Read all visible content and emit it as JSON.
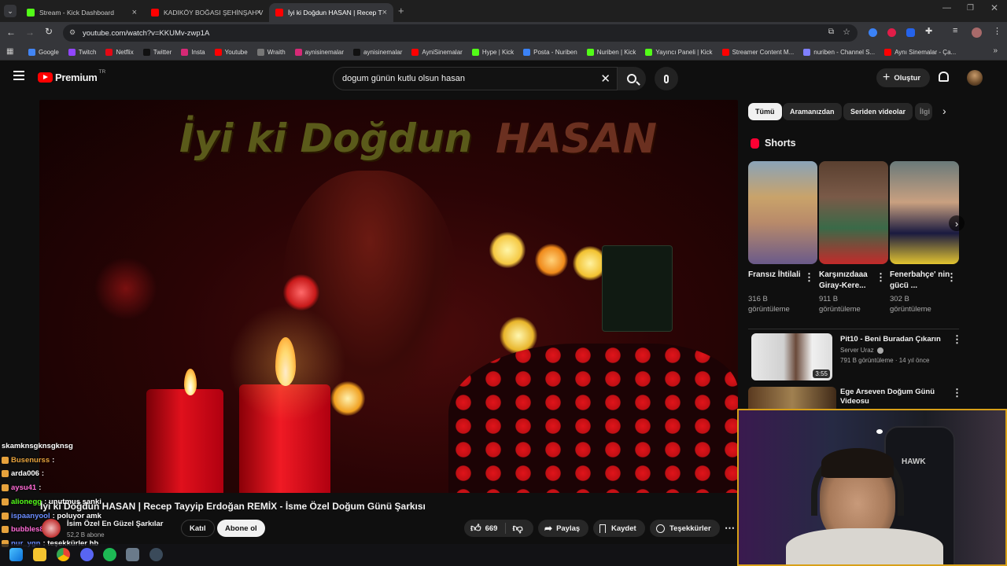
{
  "browser": {
    "tabs": [
      {
        "label": "Stream - Kick Dashboard",
        "color": "#53fc18"
      },
      {
        "label": "KADIKÖY BOĞASI ŞEHİNŞAH V",
        "color": "#ff0000"
      },
      {
        "label": "İyi ki Doğdun HASAN | Recep T",
        "color": "#ff0000"
      }
    ],
    "url": "youtube.com/watch?v=KKUMv-zwp1A",
    "bookmarks": [
      {
        "label": "Google",
        "color": "#4285f4"
      },
      {
        "label": "Twitch",
        "color": "#9146ff"
      },
      {
        "label": "Netflix",
        "color": "#e50914"
      },
      {
        "label": "Twitter",
        "color": "#111111"
      },
      {
        "label": "Insta",
        "color": "#d62976"
      },
      {
        "label": "Youtube",
        "color": "#ff0000"
      },
      {
        "label": "Wraith",
        "color": "#777777"
      },
      {
        "label": "aynisinemalar",
        "color": "#d62976"
      },
      {
        "label": "aynisinemalar",
        "color": "#111111"
      },
      {
        "label": "AyniSinemalar",
        "color": "#ff0000"
      },
      {
        "label": "Hype | Kick",
        "color": "#53fc18"
      },
      {
        "label": "Posta - Nuriben",
        "color": "#3b82f6"
      },
      {
        "label": "Nuriben | Kick",
        "color": "#53fc18"
      },
      {
        "label": "Yayıncı Paneli | Kick",
        "color": "#53fc18"
      },
      {
        "label": "Streamer Content M...",
        "color": "#ff0000"
      },
      {
        "label": "nuriben - Channel S...",
        "color": "#8080ff"
      },
      {
        "label": "Aynı Sinemalar - Ça...",
        "color": "#ff0000"
      }
    ]
  },
  "youtube": {
    "logo_text": "Premium",
    "region": "TR",
    "search_value": "dogum günün kutlu olsun hasan",
    "create_label": "Oluştur"
  },
  "video": {
    "overlay_left": "İyi ki Doğdun",
    "overlay_right": "HASAN",
    "title": "İyi ki Doğdun HASAN | Recep Tayyip Erdoğan REMİX - İsme Özel Doğum Günü Şarkısı",
    "channel": "İsim Özel En Güzel Şarkılar",
    "subscribers": "52,2 B abone",
    "join_label": "Katıl",
    "subscribe_label": "Abone ol",
    "likes": "669",
    "share_label": "Paylaş",
    "save_label": "Kaydet",
    "thanks_label": "Teşekkürler"
  },
  "sidebar": {
    "chips": [
      "Tümü",
      "Aramanızdan",
      "Seriden videolar",
      "İlgi"
    ],
    "shorts_heading": "Shorts",
    "shorts": [
      {
        "title": "Fransız İhtilali",
        "views": "316 B görüntüleme"
      },
      {
        "title": "Karşınızdaaa Giray-Kere...",
        "views": "911 B görüntüleme"
      },
      {
        "title": "Fenerbahçe' nin gücü ...",
        "views": "302 B görüntüleme"
      }
    ],
    "recs": [
      {
        "title": "Pit10 - Beni Buradan Çıkarın",
        "channel": "Server Uraz",
        "meta": "791 B görüntüleme · 14 yıl önce",
        "duration": "3:55"
      },
      {
        "title": "Ege Arseven Doğum Günü Videosu"
      }
    ]
  },
  "chat": [
    {
      "user": "",
      "text": "skamknsgknsgknsg",
      "color": "#ffffff"
    },
    {
      "user": "Busenurss",
      "text": ":",
      "color": "#e6a23c"
    },
    {
      "user": "arda006",
      "text": ":",
      "color": "#ffffff"
    },
    {
      "user": "aysu41",
      "text": ":",
      "color": "#ff6ad5"
    },
    {
      "user": "alionegg",
      "text": ": unutmus sanki",
      "color": "#53fc18"
    },
    {
      "user": "ispaanyool",
      "text": ": poluyor amk",
      "color": "#6a8cff"
    },
    {
      "user": "bubbles8",
      "text": "",
      "color": "#ff6ad5"
    },
    {
      "user": "nur_ygn",
      "text": ": teşekkürler hb",
      "color": "#6a8cff"
    }
  ],
  "webcam": {
    "cap_text": "HAWK"
  }
}
